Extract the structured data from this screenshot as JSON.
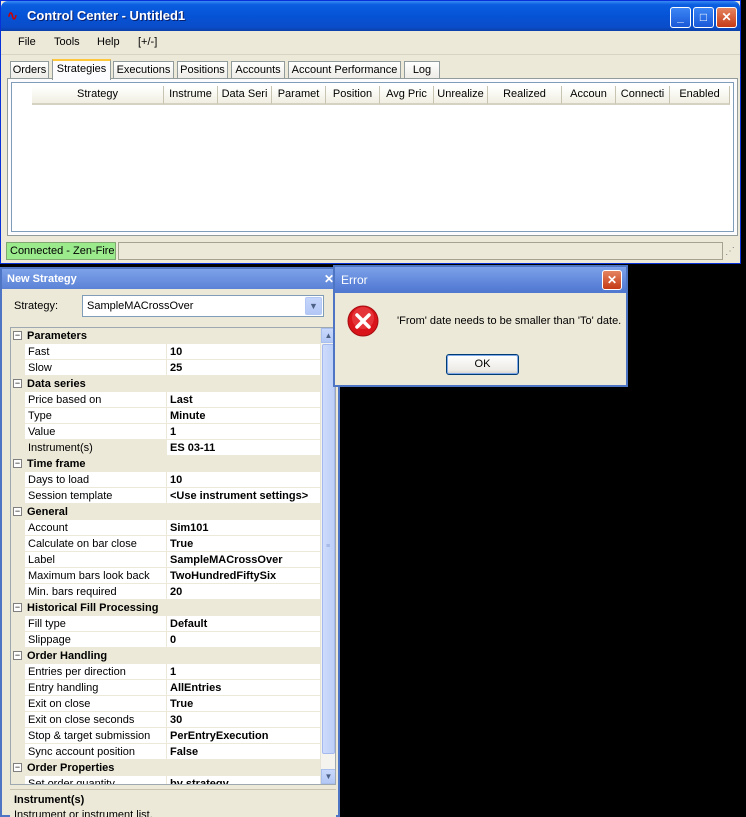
{
  "control_center": {
    "title": "Control Center - Untitled1",
    "menu": [
      "File",
      "Tools",
      "Help",
      "[+/-]"
    ],
    "tabs": [
      "Orders",
      "Strategies",
      "Executions",
      "Positions",
      "Accounts",
      "Account Performance",
      "Log"
    ],
    "active_tab": "Strategies",
    "columns": [
      "Strategy",
      "Instrume",
      "Data Seri",
      "Paramet",
      "Position",
      "Avg Pric",
      "Unrealize",
      "Realized",
      "Accoun",
      "Connecti",
      "Enabled"
    ],
    "status": {
      "connection": "Connected - Zen-Fire",
      "connection_color": "#9beb8d"
    }
  },
  "new_strategy": {
    "title": "New Strategy",
    "strategy_label": "Strategy:",
    "strategy_value": "SampleMACrossOver",
    "categories": [
      {
        "name": "Parameters",
        "props": [
          [
            "Fast",
            "10"
          ],
          [
            "Slow",
            "25"
          ]
        ]
      },
      {
        "name": "Data series",
        "props": [
          [
            "Price based on",
            "Last"
          ],
          [
            "Type",
            "Minute"
          ],
          [
            "Value",
            "1"
          ],
          [
            "Instrument(s)",
            "ES 03-11"
          ]
        ]
      },
      {
        "name": "Time frame",
        "props": [
          [
            "Days to load",
            "10"
          ],
          [
            "Session template",
            "<Use instrument settings>"
          ]
        ]
      },
      {
        "name": "General",
        "props": [
          [
            "Account",
            "Sim101"
          ],
          [
            "Calculate on bar close",
            "True"
          ],
          [
            "Label",
            "SampleMACrossOver"
          ],
          [
            "Maximum bars look back",
            "TwoHundredFiftySix"
          ],
          [
            "Min. bars required",
            "20"
          ]
        ]
      },
      {
        "name": "Historical Fill Processing",
        "props": [
          [
            "Fill type",
            "Default"
          ],
          [
            "Slippage",
            "0"
          ]
        ]
      },
      {
        "name": "Order Handling",
        "props": [
          [
            "Entries per direction",
            "1"
          ],
          [
            "Entry handling",
            "AllEntries"
          ],
          [
            "Exit on close",
            "True"
          ],
          [
            "Exit on close seconds",
            "30"
          ],
          [
            "Stop & target submission",
            "PerEntryExecution"
          ],
          [
            "Sync account position",
            "False"
          ]
        ]
      },
      {
        "name": "Order Properties",
        "props": [
          [
            "Set order quantity",
            "by strategy"
          ]
        ]
      }
    ],
    "help": {
      "title": "Instrument(s)",
      "description": "Instrument or instrument list."
    }
  },
  "error_dialog": {
    "title": "Error",
    "message": "'From' date needs to be smaller than 'To' date.",
    "ok_label": "OK"
  }
}
